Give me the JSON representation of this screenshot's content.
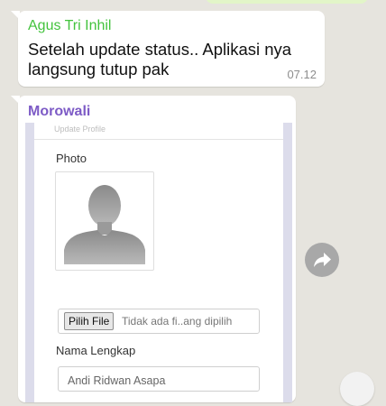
{
  "messages": [
    {
      "sender": "Agus Tri Inhil",
      "text": "Setelah update status..  Aplikasi nya langsung tutup pak",
      "time": "07.12"
    },
    {
      "sender": "Morowali",
      "form": {
        "header": "Update Profile",
        "photo_label": "Photo",
        "file_button": "Pilih File",
        "file_status": "Tidak ada fi..ang dipilih",
        "name_label": "Nama Lengkap",
        "name_value": "Andi Ridwan Asapa"
      }
    }
  ],
  "icons": {
    "share": "share-arrow-icon",
    "avatar": "avatar-placeholder-icon"
  },
  "colors": {
    "chat_background": "#e6e4de",
    "sender1": "#43c33d",
    "sender2": "#7d5bc6",
    "bubble": "#ffffff",
    "outgoing_bubble": "#e2f5c8"
  }
}
